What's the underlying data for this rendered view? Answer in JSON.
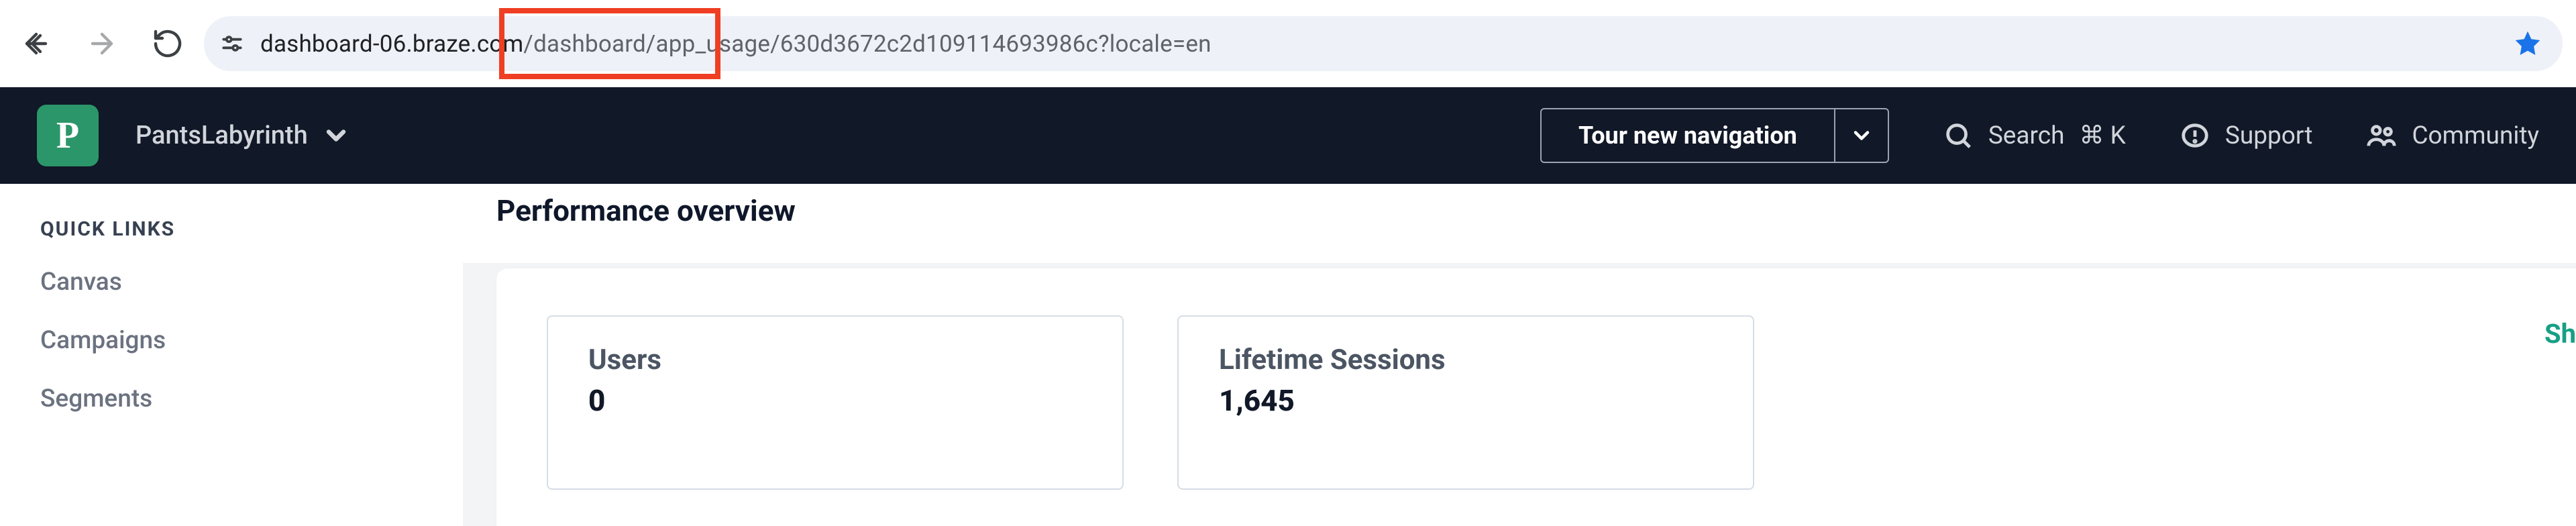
{
  "browser": {
    "url_prefix": "dashboard-06.",
    "url_host_rest": "braze.com",
    "url_path": "/dashboard/app_usage/630d3672c2d109114693986c?locale=en"
  },
  "appnav": {
    "logo_letter": "P",
    "workspace": "PantsLabyrinth",
    "tour_label": "Tour new navigation",
    "search_label": "Search",
    "search_kbd": "⌘ K",
    "support_label": "Support",
    "community_label": "Community"
  },
  "sidebar": {
    "header": "QUICK LINKS",
    "items": [
      "Canvas",
      "Campaigns",
      "Segments"
    ]
  },
  "page": {
    "title": "Performance overview",
    "show_label": "Sh"
  },
  "stats": [
    {
      "label": "Users",
      "value": "0"
    },
    {
      "label": "Lifetime Sessions",
      "value": "1,645"
    }
  ]
}
